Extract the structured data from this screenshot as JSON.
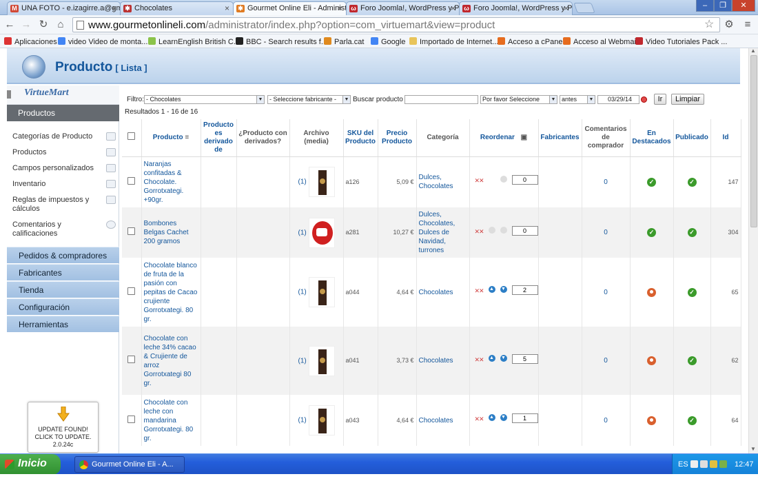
{
  "browser": {
    "tabs": [
      {
        "label": "UNA FOTO - e.izagirre.a@gm",
        "icon": "gmail-icon",
        "color": "#d14836"
      },
      {
        "label": "Chocolates",
        "icon": "joomla-icon",
        "color": "#b33"
      },
      {
        "label": "Gourmet Online Eli - Administ",
        "icon": "joomla-icon",
        "color": "#e07b22"
      },
      {
        "label": "Foro Joomla!, WordPress y P",
        "icon": "forum-icon",
        "color": "#c0282e"
      },
      {
        "label": "Foro Joomla!, WordPress y P",
        "icon": "forum-icon",
        "color": "#c0282e"
      }
    ],
    "url_host": "www.gourmetonlineli.com",
    "url_path": "/administrator/index.php?option=com_virtuemart&view=product",
    "bookmarks": [
      {
        "label": "Aplicaciones",
        "color": "#d33"
      },
      {
        "label": "video Video de monta...",
        "color": "#4285f4"
      },
      {
        "label": "LearnEnglish  British C...",
        "color": "#8bc34a"
      },
      {
        "label": "BBC - Search results f...",
        "color": "#222"
      },
      {
        "label": "Parla.cat",
        "color": "#e08a1e"
      },
      {
        "label": "Google",
        "color": "#4285f4"
      },
      {
        "label": "Importado de Internet...",
        "color": "#e8c45a"
      },
      {
        "label": "Acceso a cPanel",
        "color": "#e66c1f"
      },
      {
        "label": "Acceso al Webmail",
        "color": "#e66c1f"
      },
      {
        "label": "Video Tutoriales Pack ...",
        "color": "#c0282e"
      }
    ]
  },
  "header": {
    "title": "Producto",
    "subtitle": "[ Lista ]"
  },
  "sidebar": {
    "logo": "VirtueMart",
    "section_title": "Productos",
    "items": [
      {
        "label": "Categorías de Producto"
      },
      {
        "label": "Productos"
      },
      {
        "label": "Campos personalizados"
      },
      {
        "label": "Inventario"
      },
      {
        "label": "Reglas de impuestos y cálculos"
      },
      {
        "label": "Comentarios y calificaciones"
      }
    ],
    "sections": [
      {
        "label": "Pedidos & compradores"
      },
      {
        "label": "Fabricantes"
      },
      {
        "label": "Tienda"
      },
      {
        "label": "Configuración"
      },
      {
        "label": "Herramientas"
      }
    ],
    "update_notice": {
      "line1": "UPDATE FOUND!",
      "line2": "CLICK TO UPDATE.",
      "version": "2.0.24c"
    }
  },
  "filter": {
    "label": "Filtro:",
    "category_selected": "- Chocolates",
    "manufacturer_selected": "- Seleccione fabricante -",
    "search_label": "Buscar producto",
    "search_value": "",
    "select_placeholder": "Por favor Seleccione",
    "when_selected": "antes",
    "date_value": "03/29/14",
    "go_button": "Ir",
    "clear_button": "Limpiar",
    "results_text": "Resultados 1 - 16 de 16"
  },
  "table": {
    "headers": {
      "product": "Producto",
      "derived": "Producto es derivado de",
      "has_derived": "¿Producto con derivados?",
      "media": "Archivo (media)",
      "sku": "SKU del Producto",
      "price": "Precio Producto",
      "category": "Categoría",
      "reorder": "Reordenar",
      "manufacturers": "Fabricantes",
      "reviews": "Comentarios de comprador",
      "featured": "En Destacados",
      "published": "Publicado",
      "id": "Id"
    },
    "rows": [
      {
        "name": "Naranjas confitadas & Chocolate. Gorrotxategi. +90gr.",
        "media": "(1)",
        "sku": "a126",
        "price": "5,09 €",
        "category": "Dulces, Chocolates",
        "order": "0",
        "up": false,
        "down": false,
        "reviews": "0",
        "featured": true,
        "published": true,
        "id": "147",
        "img": "bar"
      },
      {
        "name": "Bombones Belgas Cachet 200 gramos",
        "media": "(1)",
        "sku": "a281",
        "price": "10,27 €",
        "category": "Dulces, Chocolates, Dulces de Navidad, turrones",
        "order": "0",
        "up": false,
        "down": false,
        "reviews": "0",
        "featured": true,
        "published": true,
        "id": "304",
        "img": "round"
      },
      {
        "name": "Chocolate blanco de fruta de la pasión con pepitas de Cacao crujiente Gorrotxategi. 80 gr.",
        "media": "(1)",
        "sku": "a044",
        "price": "4,64 €",
        "category": "Chocolates",
        "order": "2",
        "up": true,
        "down": true,
        "reviews": "0",
        "featured": false,
        "published": true,
        "id": "65",
        "img": "bar"
      },
      {
        "name": "Chocolate con leche 34% cacao & Crujiente de arroz Gorrotxategi 80 gr.",
        "media": "(1)",
        "sku": "a041",
        "price": "3,73 €",
        "category": "Chocolates",
        "order": "5",
        "up": true,
        "down": true,
        "reviews": "0",
        "featured": false,
        "published": true,
        "id": "62",
        "img": "bar"
      },
      {
        "name": "Chocolate con leche con mandarina Gorrotxategi. 80 gr.",
        "media": "(1)",
        "sku": "a043",
        "price": "4,64 €",
        "category": "Chocolates",
        "order": "1",
        "up": true,
        "down": true,
        "reviews": "0",
        "featured": false,
        "published": true,
        "id": "64",
        "img": "bar"
      }
    ]
  },
  "taskbar": {
    "start_label": "Inicio",
    "task_label": "Gourmet Online Eli - A...",
    "language": "ES",
    "clock": "12:47"
  }
}
